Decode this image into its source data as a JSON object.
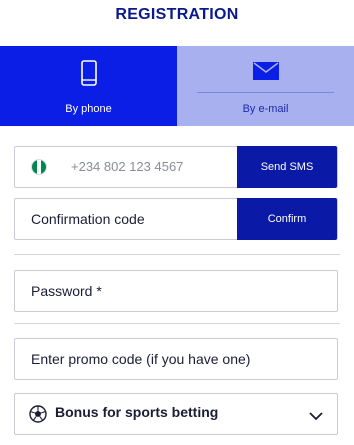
{
  "page": {
    "title": "REGISTRATION"
  },
  "tabs": [
    {
      "label": "By phone",
      "icon": "phone-icon",
      "active": true
    },
    {
      "label": "By e-mail",
      "icon": "envelope-icon",
      "active": false
    }
  ],
  "phone": {
    "value": "+234 802 123 4567",
    "flag": "nigeria-flag-icon",
    "send_button": "Send SMS"
  },
  "confirmation": {
    "placeholder": "Confirmation code",
    "confirm_button": "Confirm"
  },
  "password": {
    "placeholder": "Password *"
  },
  "promo": {
    "placeholder": "Enter promo code (if you have one)"
  },
  "bonus": {
    "label": "Bonus for sports betting",
    "icon": "soccer-ball-icon"
  },
  "colors": {
    "title": "#0a1a8c",
    "active_tab": "#0a1ee6",
    "inactive_tab": "#a9b0f0",
    "button": "#0a1aa6",
    "flag_green": "#008751"
  }
}
